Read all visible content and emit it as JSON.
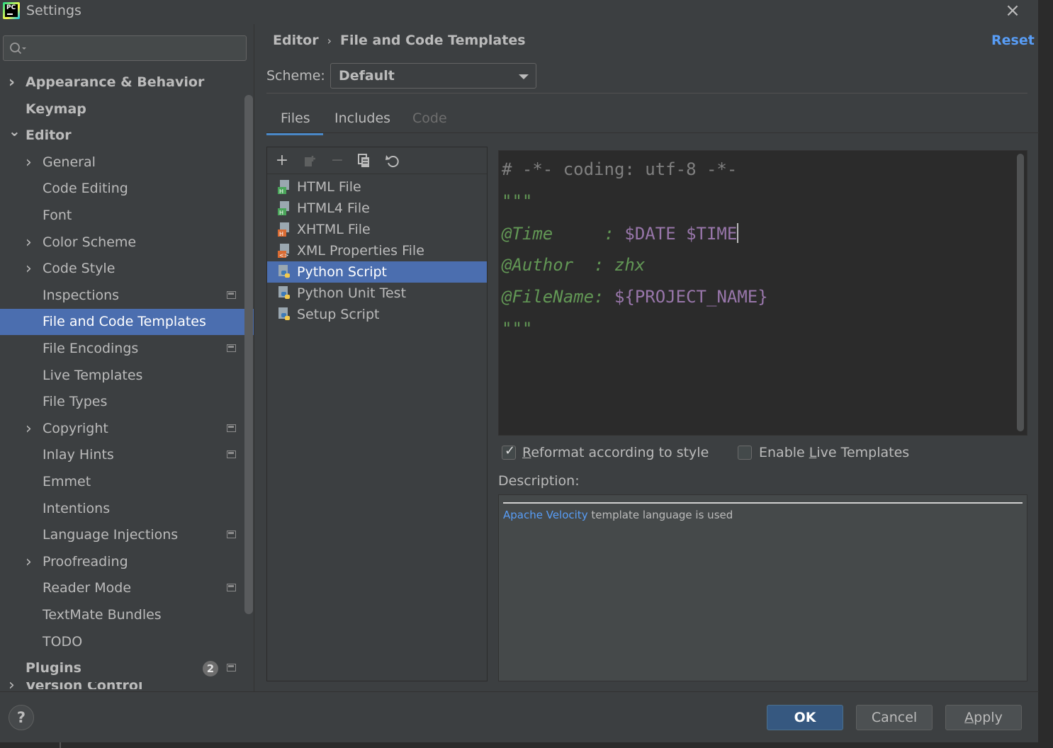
{
  "window": {
    "title": "Settings"
  },
  "sidebar": {
    "search_placeholder": "",
    "items": [
      {
        "label": "Appearance & Behavior",
        "bold": true,
        "chevron": ">",
        "level": 0
      },
      {
        "label": "Keymap",
        "bold": true,
        "level": 0
      },
      {
        "label": "Editor",
        "bold": true,
        "chevron": "v",
        "level": 0
      },
      {
        "label": "General",
        "chevron": ">",
        "level": 1
      },
      {
        "label": "Code Editing",
        "level": 1
      },
      {
        "label": "Font",
        "level": 1
      },
      {
        "label": "Color Scheme",
        "chevron": ">",
        "level": 1
      },
      {
        "label": "Code Style",
        "chevron": ">",
        "level": 1
      },
      {
        "label": "Inspections",
        "level": 1,
        "project_icon": true
      },
      {
        "label": "File and Code Templates",
        "level": 1,
        "selected": true
      },
      {
        "label": "File Encodings",
        "level": 1,
        "project_icon": true
      },
      {
        "label": "Live Templates",
        "level": 1
      },
      {
        "label": "File Types",
        "level": 1
      },
      {
        "label": "Copyright",
        "chevron": ">",
        "level": 1,
        "project_icon": true
      },
      {
        "label": "Inlay Hints",
        "level": 1,
        "project_icon": true
      },
      {
        "label": "Emmet",
        "level": 1
      },
      {
        "label": "Intentions",
        "level": 1
      },
      {
        "label": "Language Injections",
        "level": 1,
        "project_icon": true
      },
      {
        "label": "Proofreading",
        "chevron": ">",
        "level": 1
      },
      {
        "label": "Reader Mode",
        "level": 1,
        "project_icon": true
      },
      {
        "label": "TextMate Bundles",
        "level": 1
      },
      {
        "label": "TODO",
        "level": 1
      },
      {
        "label": "Plugins",
        "bold": true,
        "level": 0,
        "badge": "2",
        "project_icon": true
      }
    ],
    "partial_item": "Version Control"
  },
  "header": {
    "breadcrumb_parent": "Editor",
    "breadcrumb_sep": "›",
    "breadcrumb_current": "File and Code Templates",
    "reset": "Reset"
  },
  "scheme": {
    "label": "Scheme:",
    "value": "Default"
  },
  "tabs": [
    {
      "label": "Files",
      "active": true
    },
    {
      "label": "Includes"
    },
    {
      "label": "Code",
      "disabled": true
    }
  ],
  "toolbar": {
    "add": "+",
    "remove": "−"
  },
  "templates": [
    {
      "label": "HTML File",
      "icon": "html-file-icon",
      "color": "#4aa55a"
    },
    {
      "label": "HTML4 File",
      "icon": "html4-file-icon",
      "color": "#4aa55a"
    },
    {
      "label": "XHTML File",
      "icon": "xhtml-file-icon",
      "color": "#d96b33"
    },
    {
      "label": "XML Properties File",
      "icon": "xml-file-icon",
      "color": "#d96b33"
    },
    {
      "label": "Python Script",
      "icon": "python-file-icon",
      "selected": true
    },
    {
      "label": "Python Unit Test",
      "icon": "python-file-icon"
    },
    {
      "label": "Setup Script",
      "icon": "python-file-icon"
    }
  ],
  "code": {
    "line1": "# -*- coding: utf-8 -*-",
    "line2": "\"\"\"",
    "line3_key": "@Time     : ",
    "line3_val": "$DATE $TIME",
    "line4_key": "@Author  : zhx",
    "line5_key": "@FileName: ",
    "line5_val": "${PROJECT_NAME}",
    "line6": "\"\"\""
  },
  "options": {
    "reformat_pre": "",
    "reformat_u": "R",
    "reformat_post": "eformat according to style",
    "reformat_checked": true,
    "live_pre": "Enable ",
    "live_u": "L",
    "live_post": "ive Templates",
    "live_checked": false
  },
  "description": {
    "label": "Description:",
    "link": "Apache Velocity",
    "text": " template language is used"
  },
  "footer": {
    "help": "?",
    "ok": "OK",
    "cancel": "Cancel",
    "apply_u": "A",
    "apply_rest": "pply"
  },
  "colors": {
    "accent": "#4b6eaf",
    "link": "#589df6",
    "doc_green": "#629755",
    "var_purple": "#9876aa"
  }
}
